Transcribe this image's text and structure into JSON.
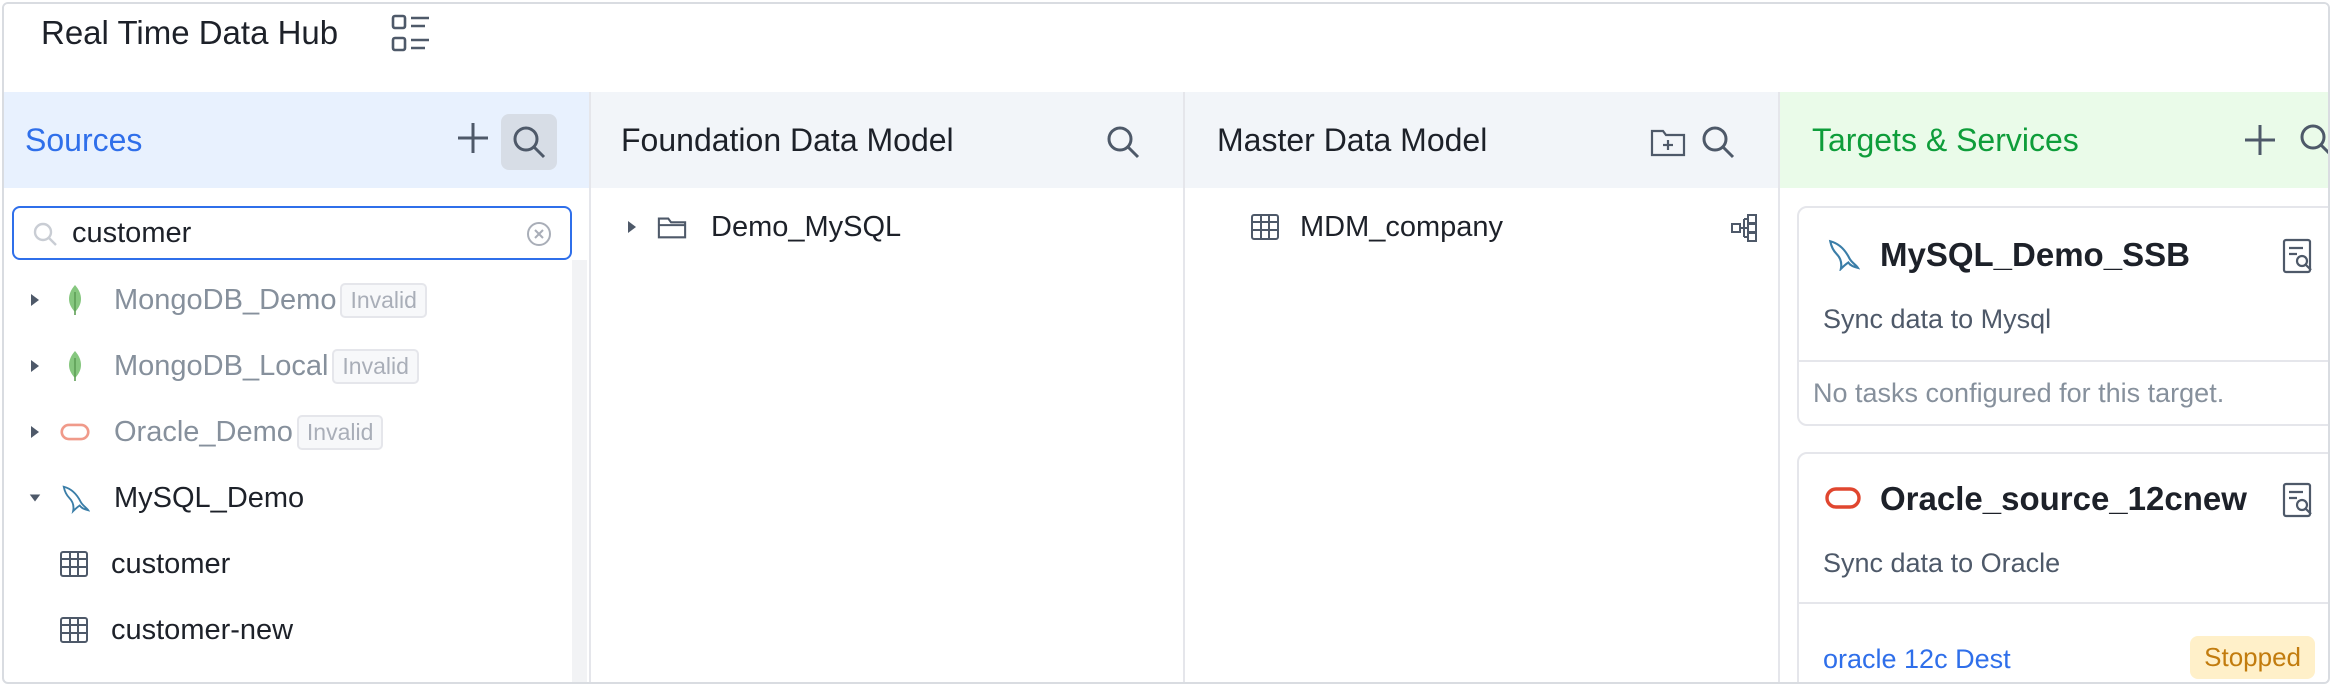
{
  "app": {
    "title": "Real Time Data Hub",
    "layout_icon": "layout-list-icon"
  },
  "columns": {
    "sources": {
      "title": "Sources",
      "search_value": "customer",
      "items": [
        {
          "label": "MongoDB_Demo",
          "status": "Invalid",
          "icon": "mongodb-leaf-icon",
          "expanded": false
        },
        {
          "label": "MongoDB_Local",
          "status": "Invalid",
          "icon": "mongodb-leaf-icon",
          "expanded": false
        },
        {
          "label": "Oracle_Demo",
          "status": "Invalid",
          "icon": "oracle-icon",
          "expanded": false
        },
        {
          "label": "MySQL_Demo",
          "status": "",
          "icon": "mysql-dolphin-icon",
          "expanded": true,
          "children": [
            {
              "label": "customer"
            },
            {
              "label": "customer-new"
            }
          ]
        }
      ]
    },
    "foundation": {
      "title": "Foundation Data Model",
      "items": [
        {
          "label": "Demo_MySQL",
          "icon": "folder-icon"
        }
      ]
    },
    "master": {
      "title": "Master Data Model",
      "items": [
        {
          "label": "MDM_company",
          "icon": "table-icon"
        }
      ]
    },
    "targets": {
      "title": "Targets & Services",
      "cards": [
        {
          "title": "MySQL_Demo_SSB",
          "description": "Sync data to Mysql",
          "empty_text": "No tasks configured for this target."
        },
        {
          "title": "Oracle_source_12cnew",
          "description": "Sync data to Oracle",
          "task": "oracle 12c Dest",
          "task_status": "Stopped"
        }
      ]
    }
  },
  "colors": {
    "accent_blue": "#2f6fea",
    "accent_green": "#0e9d3a",
    "sources_header_bg": "#e8f1fe",
    "targets_header_bg": "#eafbe9",
    "model_header_bg": "#f2f5f9",
    "stopped_bg": "#fff0c9",
    "stopped_text": "#c27c0e"
  }
}
